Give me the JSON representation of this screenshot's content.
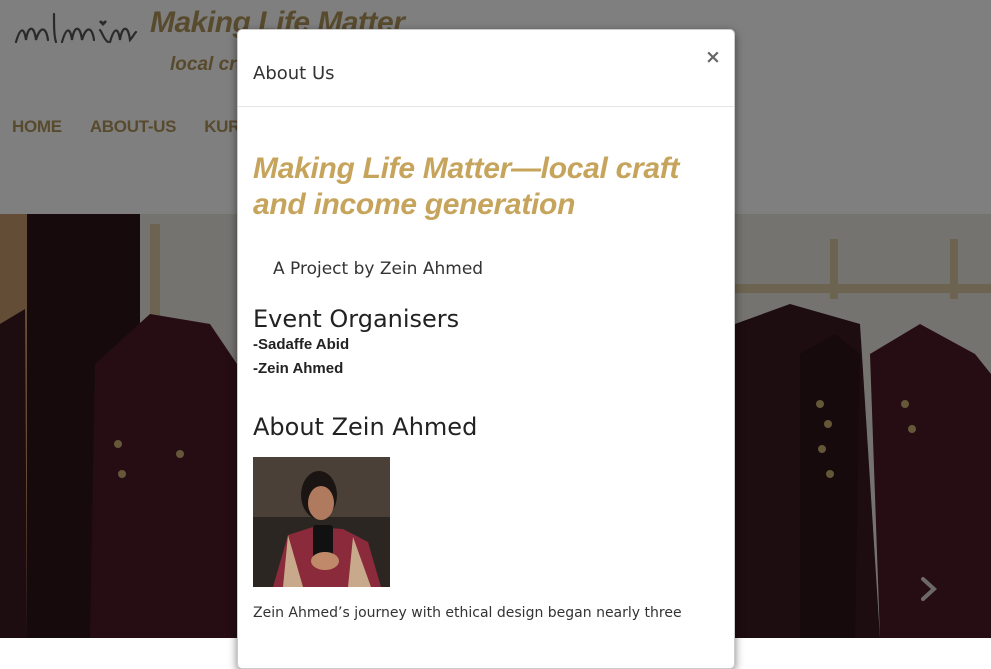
{
  "site": {
    "title": "Making Life Matter",
    "tagline": "local cra",
    "nav": [
      {
        "label": "HOME"
      },
      {
        "label": "ABOUT-US"
      },
      {
        "label": "KURT"
      }
    ]
  },
  "modal": {
    "title": "About Us",
    "close_label": "×",
    "heading": "Making Life Matter—local craft and income generation",
    "project_line": "A Project by Zein Ahmed",
    "organisers_heading": "Event Organisers",
    "organisers": [
      "-Sadaffe Abid",
      "-Zein Ahmed"
    ],
    "about_heading": "About Zein Ahmed",
    "bio_text": "Zein Ahmed’s journey with ethical design began nearly three"
  },
  "colors": {
    "brand_gold": "#b1955a",
    "heading_gold": "#c6a45c",
    "overlay": "rgba(0,0,0,0.5)"
  },
  "icons": {
    "logo": "mlm-script-logo",
    "close": "close-icon",
    "carousel_next": "chevron-right-icon"
  }
}
